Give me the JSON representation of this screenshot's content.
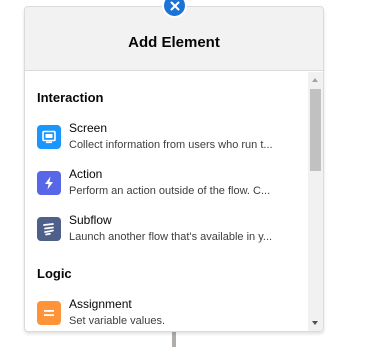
{
  "panel": {
    "title": "Add Element"
  },
  "sections": [
    {
      "title": "Interaction",
      "items": [
        {
          "name": "Screen",
          "description": "Collect information from users who run t...",
          "icon": "screen-icon",
          "color": "#1b96ff"
        },
        {
          "name": "Action",
          "description": "Perform an action outside of the flow. C...",
          "icon": "lightning-bolt-icon",
          "color": "#5867e8"
        },
        {
          "name": "Subflow",
          "description": "Launch another flow that's available in y...",
          "icon": "subflow-icon",
          "color": "#4e5f8a"
        }
      ]
    },
    {
      "title": "Logic",
      "items": [
        {
          "name": "Assignment",
          "description": "Set variable values.",
          "icon": "assignment-icon",
          "color": "#fe9339"
        }
      ]
    }
  ],
  "colors": {
    "close_button": "#1b73d6",
    "header_bg": "#f3f2f2"
  }
}
